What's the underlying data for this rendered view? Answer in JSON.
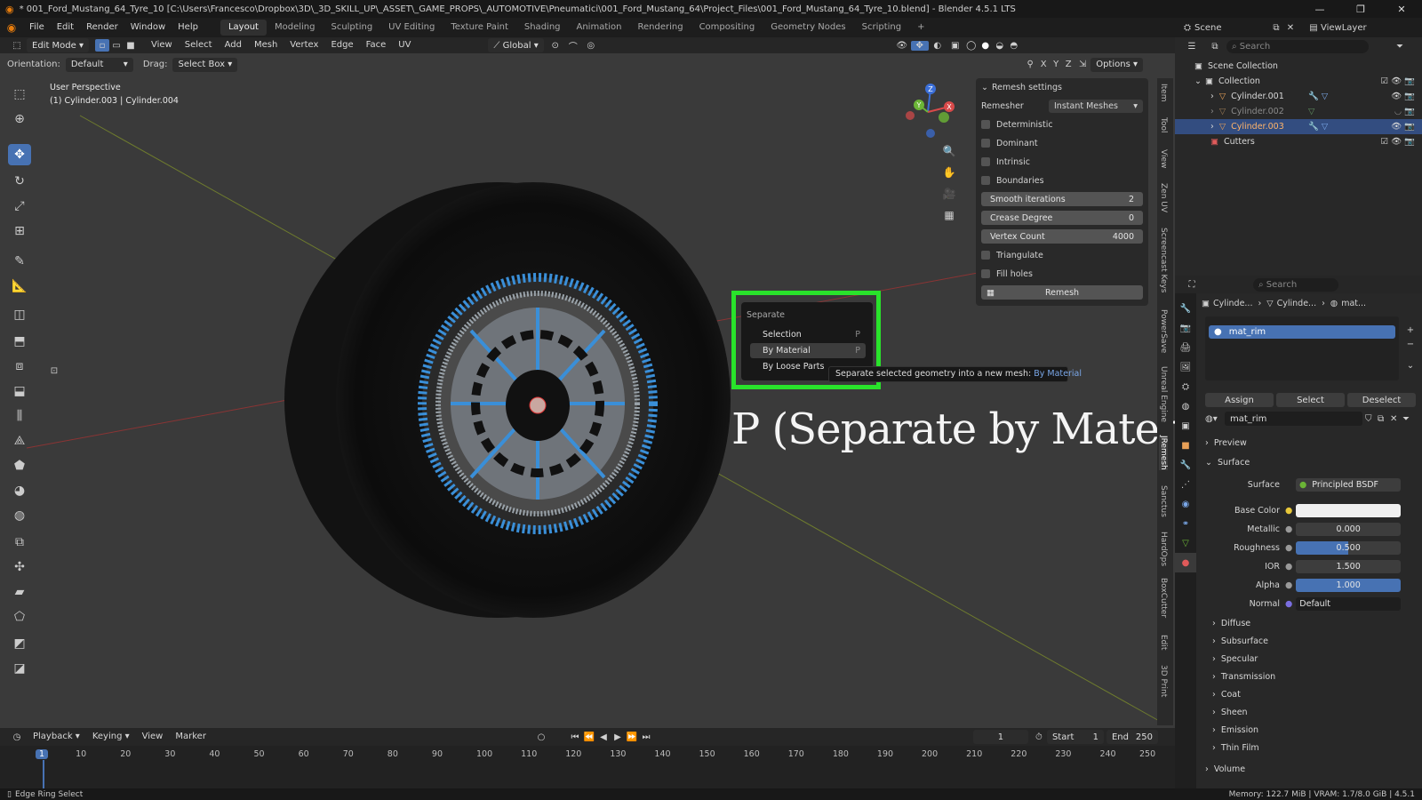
{
  "window": {
    "title": "* 001_Ford_Mustang_64_Tyre_10 [C:\\Users\\Francesco\\Dropbox\\3D\\_3D_SKILL_UP\\_ASSET\\_GAME_PROPS\\_AUTOMOTIVE\\Pneumatici\\001_Ford_Mustang_64\\Project_Files\\001_Ford_Mustang_64_Tyre_10.blend] - Blender 4.5.1 LTS"
  },
  "menus": [
    "File",
    "Edit",
    "Render",
    "Window",
    "Help"
  ],
  "workspaces": [
    "Layout",
    "Modeling",
    "Sculpting",
    "UV Editing",
    "Texture Paint",
    "Shading",
    "Animation",
    "Rendering",
    "Compositing",
    "Geometry Nodes",
    "Scripting"
  ],
  "scene": {
    "label": "Scene",
    "viewlayer": "ViewLayer"
  },
  "viewport": {
    "mode": "Edit Mode",
    "header_menus": [
      "View",
      "Select",
      "Add",
      "Mesh",
      "Vertex",
      "Edge",
      "Face",
      "UV"
    ],
    "transform": "Global",
    "orientation_label": "Orientation:",
    "orientation_value": "Default",
    "drag_label": "Drag:",
    "drag_value": "Select Box",
    "axes": [
      "X",
      "Y",
      "Z"
    ],
    "options": "Options",
    "info_line1": "User Perspective",
    "info_line2": "(1) Cylinder.003 | Cylinder.004"
  },
  "remesh": {
    "title": "Remesh settings",
    "remesher_label": "Remesher",
    "remesher_value": "Instant Meshes",
    "checkboxes": [
      "Deterministic",
      "Dominant",
      "Intrinsic",
      "Boundaries"
    ],
    "fields": [
      {
        "label": "Smooth iterations",
        "value": "2"
      },
      {
        "label": "Crease Degree",
        "value": "0"
      },
      {
        "label": "Vertex Count",
        "value": "4000"
      }
    ],
    "checkboxes2": [
      "Triangulate",
      "Fill holes"
    ],
    "button": "Remesh"
  },
  "separate_menu": {
    "title": "Separate",
    "items": [
      {
        "label": "Selection",
        "key": "P"
      },
      {
        "label": "By Material",
        "key": "P"
      },
      {
        "label": "By Loose Parts",
        "key": ""
      }
    ],
    "tooltip_prefix": "Separate selected geometry into a new mesh: ",
    "tooltip_value": "By Material"
  },
  "overlay_caption": "P (Separate by Material)",
  "sidebar_tabs": [
    "Item",
    "Tool",
    "View",
    "Zen UV",
    "Screencast Keys",
    "PowerSave",
    "Unreal Engine",
    "JRemesh",
    "Sanctus",
    "HardOps",
    "BoxCutter",
    "Edit",
    "3D Print"
  ],
  "timeline": {
    "menus": [
      "Playback",
      "Keying",
      "View",
      "Marker"
    ],
    "current": "1",
    "start_label": "Start",
    "start": "1",
    "end_label": "End",
    "end": "250",
    "ticks": [
      "1",
      "10",
      "20",
      "30",
      "40",
      "50",
      "60",
      "70",
      "80",
      "90",
      "100",
      "110",
      "120",
      "130",
      "140",
      "150",
      "160",
      "170",
      "180",
      "190",
      "200",
      "210",
      "220",
      "230",
      "240",
      "250"
    ]
  },
  "status": {
    "left": "Edge Ring Select",
    "right": "Memory: 122.7 MiB | VRAM: 1.7/8.0 GiB | 4.5.1"
  },
  "outliner": {
    "search": "Search",
    "root": "Scene Collection",
    "collection": "Collection",
    "items": [
      "Cylinder.001",
      "Cylinder.002",
      "Cylinder.003"
    ],
    "cutters": "Cutters"
  },
  "properties": {
    "search": "Search",
    "breadcrumb": [
      "Cylinde...",
      "Cylinde...",
      "mat..."
    ],
    "slot": "mat_rim",
    "actions": [
      "Assign",
      "Select",
      "Deselect"
    ],
    "material_name": "mat_rim",
    "preview": "Preview",
    "surface_section": "Surface",
    "surface_label": "Surface",
    "surface_value": "Principled BSDF",
    "params": [
      {
        "label": "Base Color",
        "value": ""
      },
      {
        "label": "Metallic",
        "value": "0.000"
      },
      {
        "label": "Roughness",
        "value": "0.500"
      },
      {
        "label": "IOR",
        "value": "1.500"
      },
      {
        "label": "Alpha",
        "value": "1.000"
      },
      {
        "label": "Normal",
        "value": "Default"
      }
    ],
    "subsections": [
      "Diffuse",
      "Subsurface",
      "Specular",
      "Transmission",
      "Coat",
      "Sheen",
      "Emission",
      "Thin Film"
    ],
    "volume": "Volume"
  },
  "colors": {
    "accent": "#4772b3",
    "highlight_green": "#29e32b",
    "selected_edge": "#3a8fd8"
  }
}
